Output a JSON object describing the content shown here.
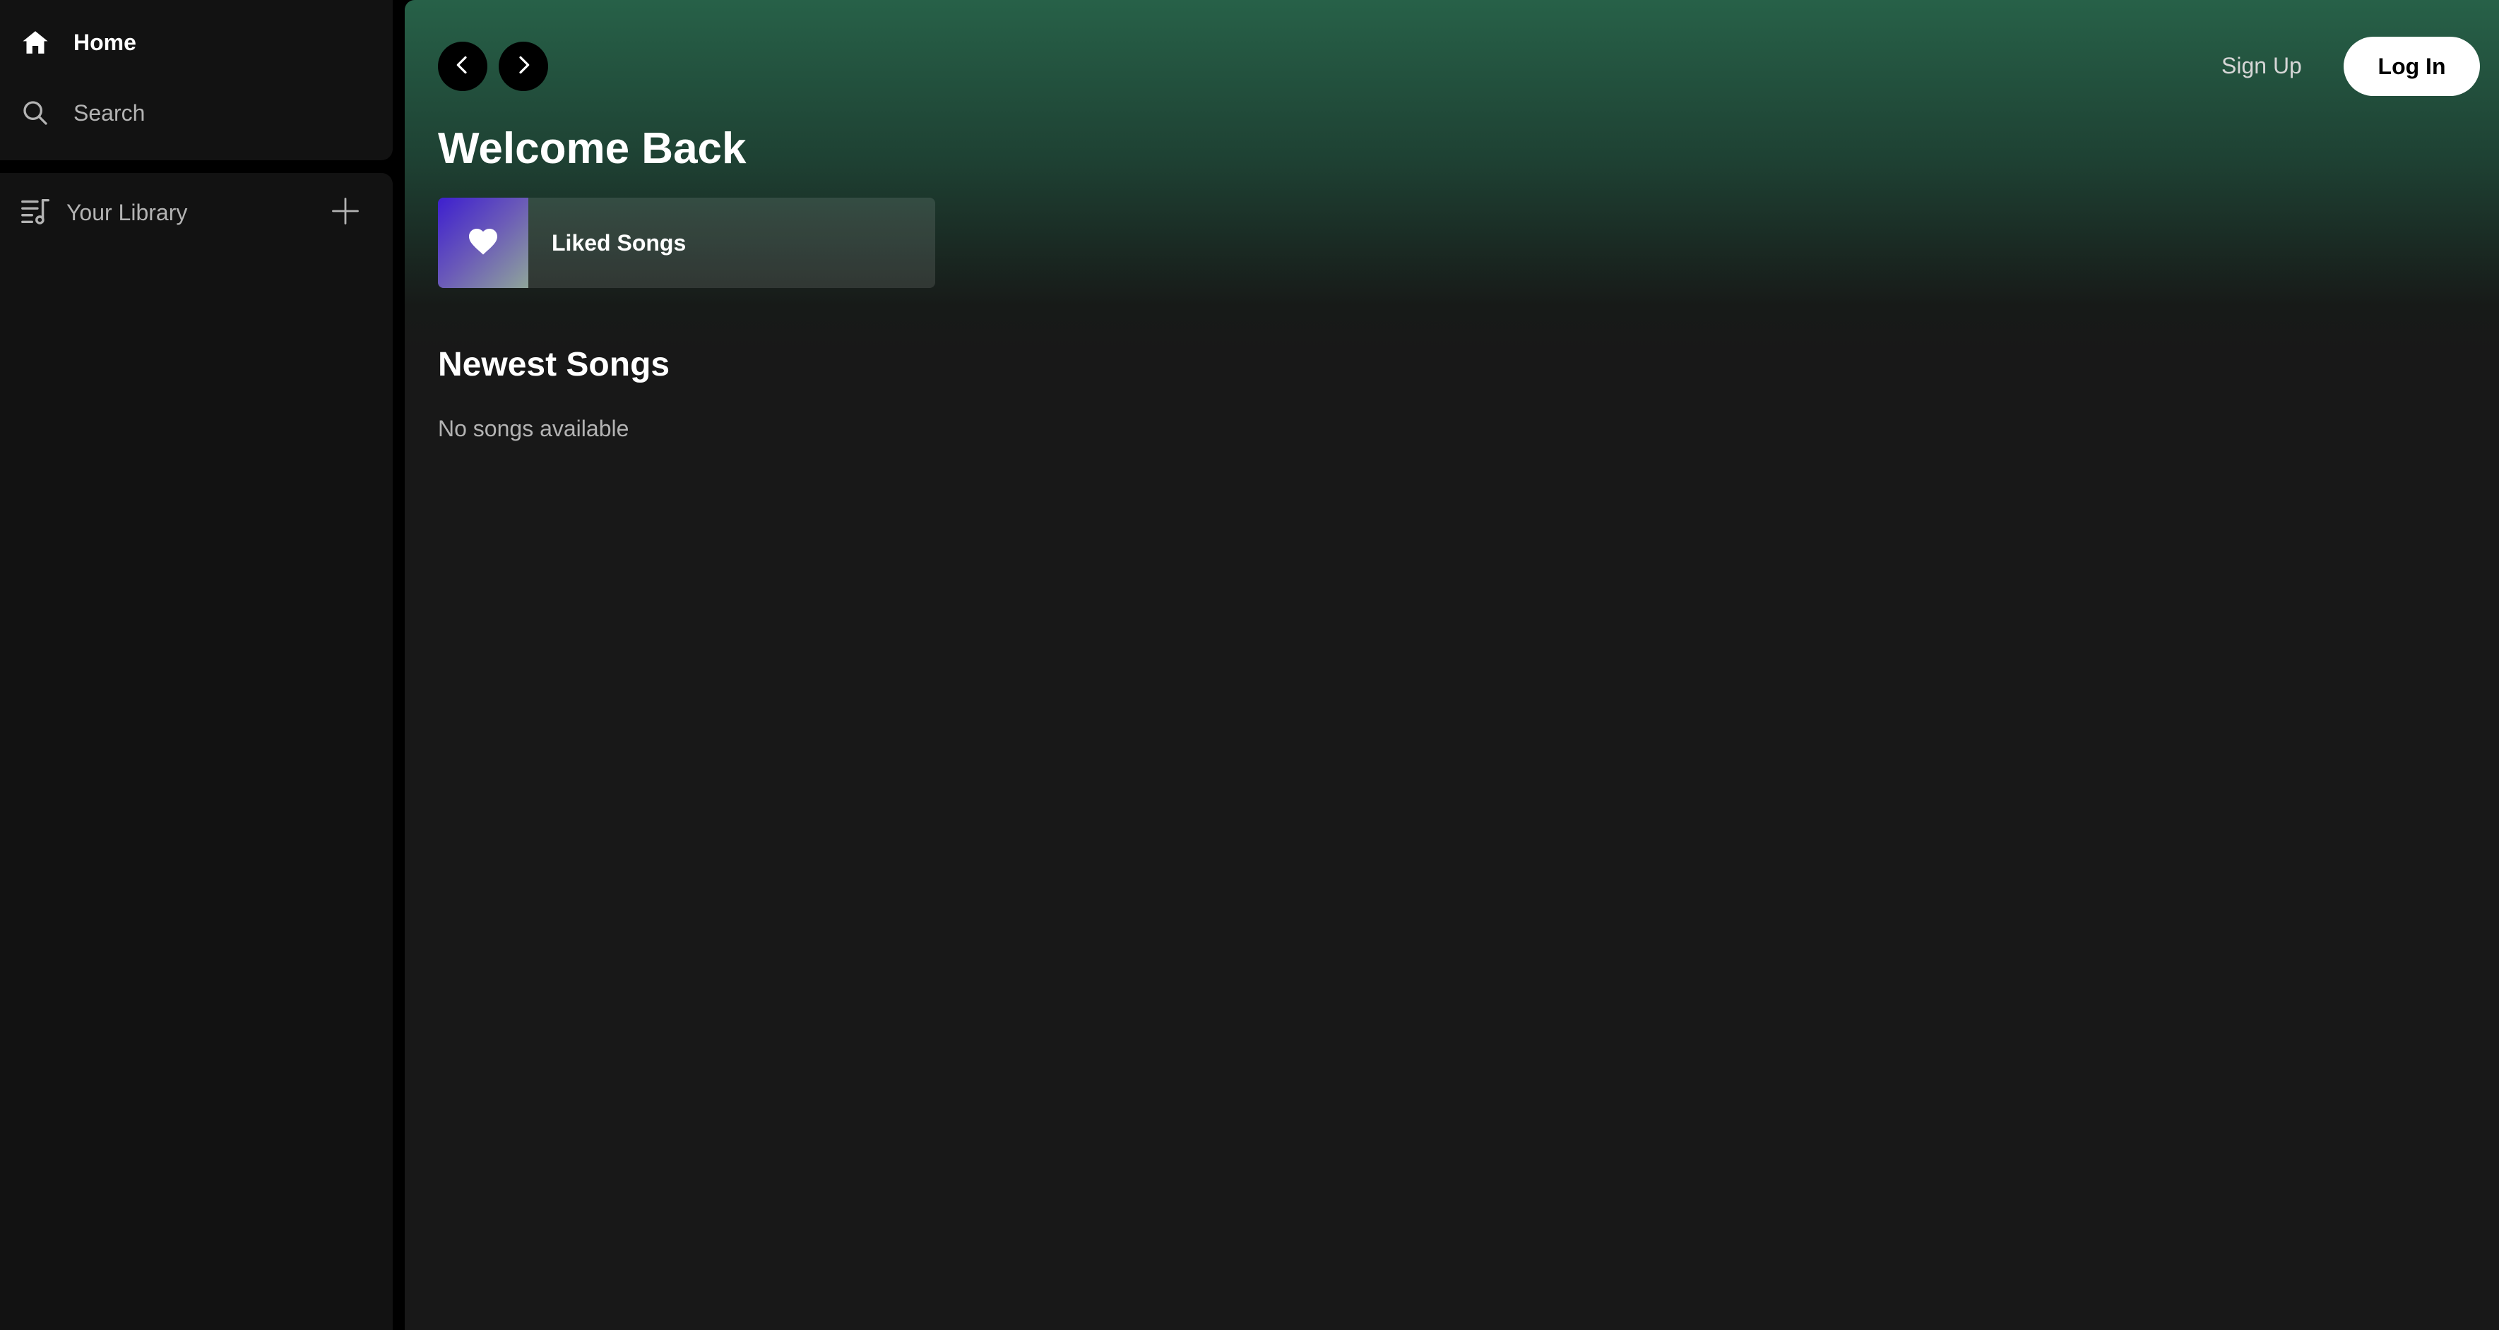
{
  "sidebar": {
    "nav": {
      "home_label": "Home",
      "search_label": "Search"
    },
    "library": {
      "label": "Your Library"
    }
  },
  "header": {
    "signup_label": "Sign Up",
    "login_label": "Log In"
  },
  "main": {
    "title": "Welcome Back",
    "liked_songs_label": "Liked Songs",
    "newest_section_title": "Newest Songs",
    "empty_message": "No songs available"
  },
  "icons": {
    "home": "home-icon",
    "search": "search-icon",
    "library": "library-icon",
    "add": "plus-icon",
    "back": "chevron-left-icon",
    "forward": "chevron-right-icon",
    "liked": "heart-icon"
  },
  "colors": {
    "accent_gradient_top": "#276148",
    "background": "#181818",
    "sidebar": "#121212",
    "muted_text": "#b3b3b3",
    "liked_art_start": "#3d1fcf",
    "liked_art_end": "#8fa59a"
  }
}
